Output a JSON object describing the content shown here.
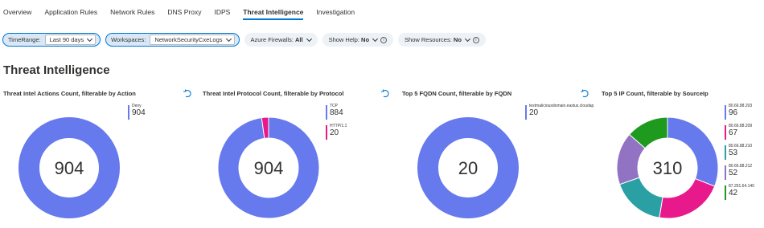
{
  "tabs": [
    {
      "label": "Overview",
      "active": false
    },
    {
      "label": "Application Rules",
      "active": false
    },
    {
      "label": "Network Rules",
      "active": false
    },
    {
      "label": "DNS Proxy",
      "active": false
    },
    {
      "label": "IDPS",
      "active": false
    },
    {
      "label": "Threat Intelligence",
      "active": true
    },
    {
      "label": "Investigation",
      "active": false
    }
  ],
  "params": {
    "time_range": {
      "label": "TimeRange:",
      "value": "Last 90 days"
    },
    "workspaces": {
      "label": "Workspaces:",
      "value": "NetworkSecurityCxeLogs"
    },
    "azure_firewalls": {
      "label": "Azure Firewalls:",
      "value": "All"
    },
    "show_help": {
      "label": "Show Help:",
      "value": "No"
    },
    "show_resources": {
      "label": "Show Resources:",
      "value": "No"
    }
  },
  "section_title": "Threat Intelligence",
  "colors": {
    "accent": "#0078d4",
    "blue": "#6679ed",
    "pink": "#e8198a",
    "teal": "#2aa0a4",
    "purple": "#9272c3",
    "green": "#1e9b1e"
  },
  "tiles": [
    {
      "title": "Threat Intel Actions Count, filterable by Action",
      "total": "904",
      "slices": [
        {
          "label": "Deny",
          "value": 904,
          "display": "904",
          "color": "#6679ed"
        }
      ]
    },
    {
      "title": "Threat Intel Protocol Count, filterable by Protocol",
      "total": "904",
      "slices": [
        {
          "label": "TCP",
          "value": 884,
          "display": "884",
          "color": "#6679ed"
        },
        {
          "label": "HTTP/1.1",
          "value": 20,
          "display": "20",
          "color": "#e8198a"
        }
      ]
    },
    {
      "title": "Top 5 FQDN Count, filterable by FQDN",
      "total": "20",
      "slices": [
        {
          "label": "testmaliciousdomain.eastus.cloudap",
          "value": 20,
          "display": "20",
          "color": "#6679ed"
        }
      ]
    },
    {
      "title": "Top 5 IP Count, filterable by SourceIp",
      "total": "310",
      "slices": [
        {
          "label": "80.66.88.203",
          "value": 96,
          "display": "96",
          "color": "#6679ed"
        },
        {
          "label": "80.66.88.209",
          "value": 67,
          "display": "67",
          "color": "#e8198a"
        },
        {
          "label": "80.66.88.210",
          "value": 53,
          "display": "53",
          "color": "#2aa0a4"
        },
        {
          "label": "80.66.88.212",
          "value": 52,
          "display": "52",
          "color": "#9272c3"
        },
        {
          "label": "87.251.64.140",
          "value": 42,
          "display": "42",
          "color": "#1e9b1e"
        }
      ]
    }
  ]
}
